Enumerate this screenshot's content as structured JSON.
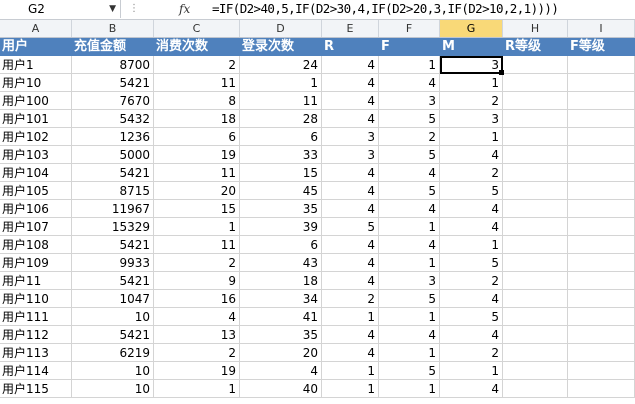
{
  "name_box": "G2",
  "formula": "=IF(D2>40,5,IF(D2>30,4,IF(D2>20,3,IF(D2>10,2,1))))",
  "fx_label": "fx",
  "columns": [
    "A",
    "B",
    "C",
    "D",
    "E",
    "F",
    "G",
    "H",
    "I"
  ],
  "selected_column": "G",
  "header_row": [
    "用户",
    "充值金额",
    "消费次数",
    "登录次数",
    "R",
    "F",
    "M",
    "R等级",
    "F等级"
  ],
  "rows": [
    [
      "用户1",
      "8700",
      "2",
      "24",
      "4",
      "1",
      "3",
      "",
      ""
    ],
    [
      "用户10",
      "5421",
      "11",
      "1",
      "4",
      "4",
      "1",
      "",
      ""
    ],
    [
      "用户100",
      "7670",
      "8",
      "11",
      "4",
      "3",
      "2",
      "",
      ""
    ],
    [
      "用户101",
      "5432",
      "18",
      "28",
      "4",
      "5",
      "3",
      "",
      ""
    ],
    [
      "用户102",
      "1236",
      "6",
      "6",
      "3",
      "2",
      "1",
      "",
      ""
    ],
    [
      "用户103",
      "5000",
      "19",
      "33",
      "3",
      "5",
      "4",
      "",
      ""
    ],
    [
      "用户104",
      "5421",
      "11",
      "15",
      "4",
      "4",
      "2",
      "",
      ""
    ],
    [
      "用户105",
      "8715",
      "20",
      "45",
      "4",
      "5",
      "5",
      "",
      ""
    ],
    [
      "用户106",
      "11967",
      "15",
      "35",
      "4",
      "4",
      "4",
      "",
      ""
    ],
    [
      "用户107",
      "15329",
      "1",
      "39",
      "5",
      "1",
      "4",
      "",
      ""
    ],
    [
      "用户108",
      "5421",
      "11",
      "6",
      "4",
      "4",
      "1",
      "",
      ""
    ],
    [
      "用户109",
      "9933",
      "2",
      "43",
      "4",
      "1",
      "5",
      "",
      ""
    ],
    [
      "用户11",
      "5421",
      "9",
      "18",
      "4",
      "3",
      "2",
      "",
      ""
    ],
    [
      "用户110",
      "1047",
      "16",
      "34",
      "2",
      "5",
      "4",
      "",
      ""
    ],
    [
      "用户111",
      "10",
      "4",
      "41",
      "1",
      "1",
      "5",
      "",
      ""
    ],
    [
      "用户112",
      "5421",
      "13",
      "35",
      "4",
      "4",
      "4",
      "",
      ""
    ],
    [
      "用户113",
      "6219",
      "2",
      "20",
      "4",
      "1",
      "2",
      "",
      ""
    ],
    [
      "用户114",
      "10",
      "19",
      "4",
      "1",
      "5",
      "1",
      "",
      ""
    ],
    [
      "用户115",
      "10",
      "1",
      "40",
      "1",
      "1",
      "4",
      "",
      ""
    ]
  ],
  "colors": {
    "header_fill": "#4f81bd",
    "selected_column_header": "#f9d978"
  }
}
